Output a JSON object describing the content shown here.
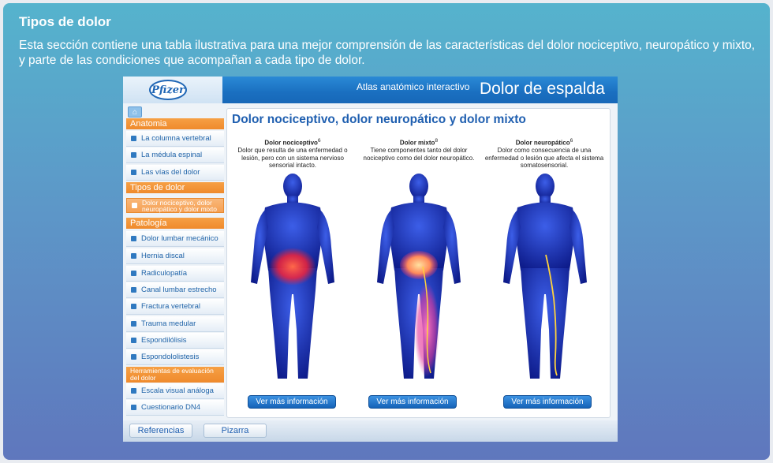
{
  "section": {
    "title": "Tipos de dolor",
    "description": "Esta sección contiene una tabla ilustrativa para una mejor comprensión de las características del dolor nociceptivo, neuropático y mixto, y parte de las condiciones que acompañan a cada tipo de dolor."
  },
  "app": {
    "logo": "Pfizer",
    "subtitle": "Atlas anatómico interactivo",
    "title": "Dolor de espalda",
    "sidebar": {
      "anatomia": {
        "label": "Anatomia",
        "items": [
          "La columna vertebral",
          "La médula espinal",
          "Las vías del dolor"
        ]
      },
      "tipos": {
        "label": "Tipos de dolor",
        "items": [
          "Dolor nociceptivo, dolor neuropático y dolor mixto"
        ]
      },
      "patologia": {
        "label": "Patología",
        "items": [
          "Dolor lumbar mecánico",
          "Hernia discal",
          "Radiculopatía",
          "Canal lumbar estrecho",
          "Fractura vertebral",
          "Trauma medular",
          "Espondilólisis",
          "Espondololistesis"
        ]
      },
      "herramientas": {
        "label": "Herramientas de evaluación del dolor",
        "items": [
          "Escala visual análoga",
          "Cuestionario DN4"
        ]
      }
    },
    "panel": {
      "title": "Dolor nociceptivo, dolor neuropático y dolor mixto",
      "columns": [
        {
          "heading": "Dolor nociceptivo",
          "sup": "6",
          "text": "Dolor que  resulta de una enfermedad o lesión, pero con un sistema nervioso sensorial intacto.",
          "button": "Ver más información"
        },
        {
          "heading": "Dolor mixto",
          "sup": "8",
          "text": "Tiene componentes tanto del dolor nociceptivo como del dolor neuropático.",
          "button": "Ver más información"
        },
        {
          "heading": "Dolor neuropático",
          "sup": "6",
          "text": "Dolor  como consecuencia de una enfermedad o lesión que afecta el sistema somatosensorial.",
          "button": "Ver más información"
        }
      ]
    },
    "bottom": {
      "references": "Referencias",
      "board": "Pizarra"
    }
  },
  "colors": {
    "accent_orange": "#ef8a2c",
    "brand_blue": "#1a6fc0",
    "pain_red": "#ff3030",
    "nerve_yellow": "#ffd23c"
  }
}
